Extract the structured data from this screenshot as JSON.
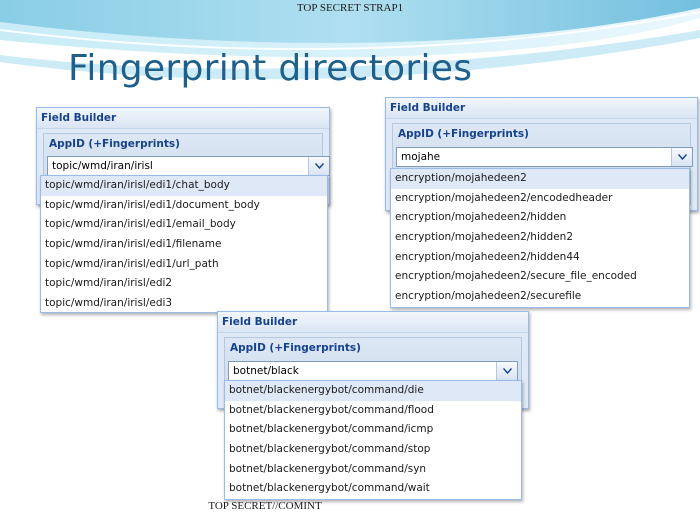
{
  "classification_top": "TOP SECRET STRAP1",
  "classification_bottom": "TOP SECRET//COMINT",
  "slide_title": "Fingerprint directories",
  "panels": [
    {
      "header": "Field Builder",
      "field_label": "AppID (+Fingerprints)",
      "input_value": "topic/wmd/iran/irisl",
      "options": [
        "topic/wmd/iran/irisl/edi1/chat_body",
        "topic/wmd/iran/irisl/edi1/document_body",
        "topic/wmd/iran/irisl/edi1/email_body",
        "topic/wmd/iran/irisl/edi1/filename",
        "topic/wmd/iran/irisl/edi1/url_path",
        "topic/wmd/iran/irisl/edi2",
        "topic/wmd/iran/irisl/edi3"
      ]
    },
    {
      "header": "Field Builder",
      "field_label": "AppID (+Fingerprints)",
      "input_value": "mojahe",
      "options": [
        "encryption/mojahedeen2",
        "encryption/mojahedeen2/encodedheader",
        "encryption/mojahedeen2/hidden",
        "encryption/mojahedeen2/hidden2",
        "encryption/mojahedeen2/hidden44",
        "encryption/mojahedeen2/secure_file_encoded",
        "encryption/mojahedeen2/securefile"
      ]
    },
    {
      "header": "Field Builder",
      "field_label": "AppID (+Fingerprints)",
      "input_value": "botnet/black",
      "options": [
        "botnet/blackenergybot/command/die",
        "botnet/blackenergybot/command/flood",
        "botnet/blackenergybot/command/icmp",
        "botnet/blackenergybot/command/stop",
        "botnet/blackenergybot/command/syn",
        "botnet/blackenergybot/command/wait"
      ]
    }
  ],
  "icons": {
    "combo_trigger": "chevron-down-icon"
  },
  "colors": {
    "title": "#1f5f8c",
    "panel_header_text": "#15428b",
    "panel_bg": "#dfe8f6",
    "selected_row": "#dfe8f6"
  }
}
